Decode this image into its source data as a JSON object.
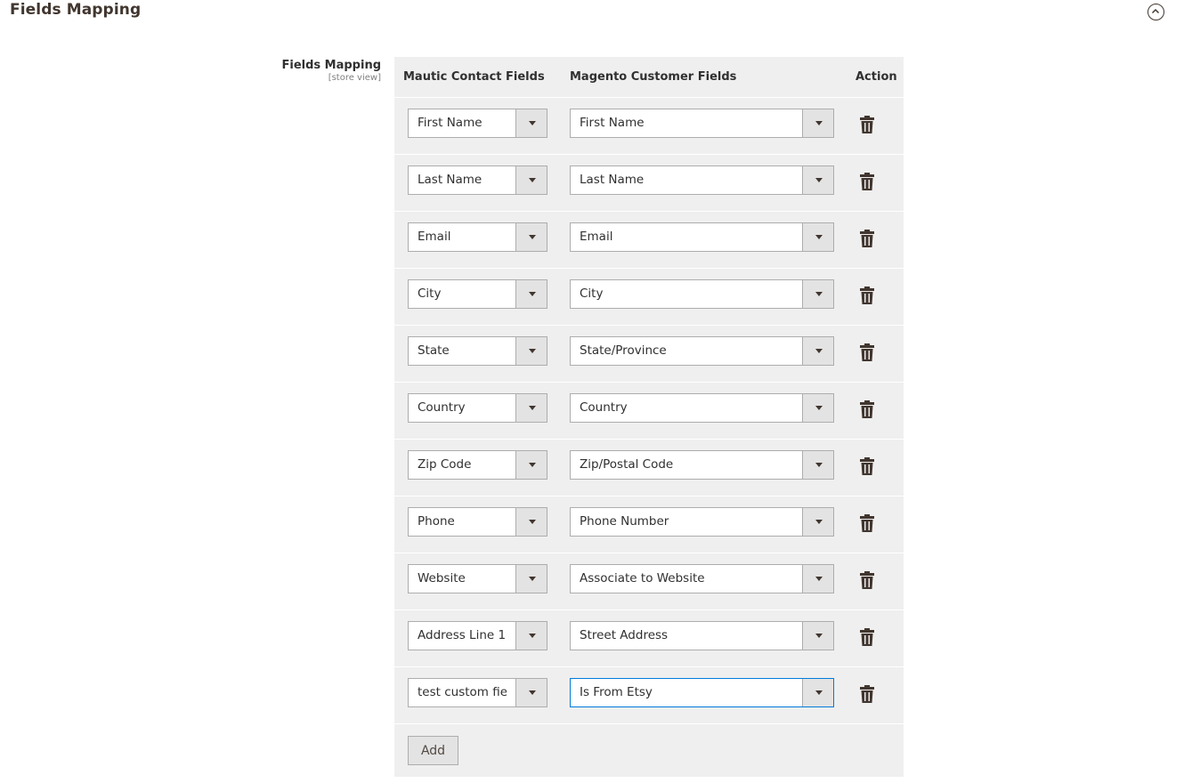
{
  "section": {
    "title": "Fields Mapping",
    "collapse_icon": "chevron-up-circle-icon"
  },
  "field": {
    "label": "Fields Mapping",
    "scope": "[store view]"
  },
  "table": {
    "headers": {
      "mautic": "Mautic Contact Fields",
      "magento": "Magento Customer Fields",
      "action": "Action"
    },
    "rows": [
      {
        "mautic": "First Name",
        "magento": "First Name"
      },
      {
        "mautic": "Last Name",
        "magento": "Last Name"
      },
      {
        "mautic": "Email",
        "magento": "Email"
      },
      {
        "mautic": "City",
        "magento": "City"
      },
      {
        "mautic": "State",
        "magento": "State/Province"
      },
      {
        "mautic": "Country",
        "magento": "Country"
      },
      {
        "mautic": "Zip Code",
        "magento": "Zip/Postal Code"
      },
      {
        "mautic": "Phone",
        "magento": "Phone Number"
      },
      {
        "mautic": "Website",
        "magento": "Associate to Website"
      },
      {
        "mautic": "Address Line 1",
        "magento": "Street Address"
      },
      {
        "mautic": "test custom field",
        "magento": "Is From Etsy"
      }
    ],
    "focused_row": 10,
    "delete_icon": "trash-icon",
    "dropdown_icon": "dropdown-arrow-icon",
    "add_label": "Add"
  },
  "colors": {
    "grid_background": "#efefef",
    "text": "#303030",
    "icon": "#41362f",
    "focus_border": "#007bdb"
  }
}
